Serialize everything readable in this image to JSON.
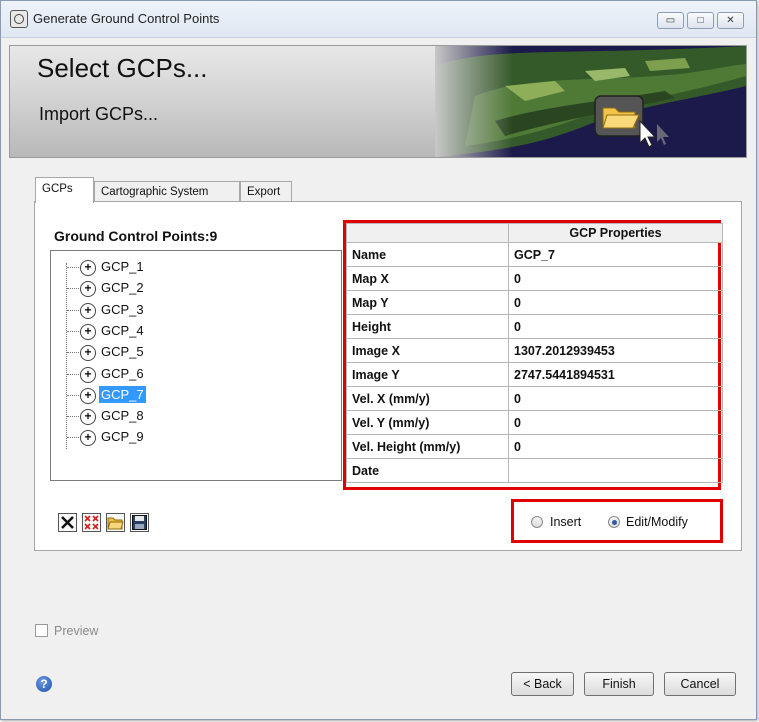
{
  "window": {
    "title": "Generate Ground Control Points",
    "minimize_glyph": "▭",
    "maximize_glyph": "□",
    "close_glyph": "✕"
  },
  "banner": {
    "title": "Select GCPs...",
    "subtitle": "Import GCPs..."
  },
  "tabs": [
    "GCPs",
    "Cartographic System",
    "Export"
  ],
  "gcp_list": {
    "heading": "Ground Control Points:",
    "count": "9",
    "items": [
      "GCP_1",
      "GCP_2",
      "GCP_3",
      "GCP_4",
      "GCP_5",
      "GCP_6",
      "GCP_7",
      "GCP_8",
      "GCP_9"
    ],
    "selected": "GCP_7"
  },
  "properties": {
    "header": "GCP Properties",
    "rows": [
      {
        "key": "Name",
        "value": "GCP_7"
      },
      {
        "key": "Map X",
        "value": "0"
      },
      {
        "key": "Map Y",
        "value": "0"
      },
      {
        "key": "Height",
        "value": "0"
      },
      {
        "key": "Image X",
        "value": "1307.2012939453"
      },
      {
        "key": "Image Y",
        "value": "2747.5441894531"
      },
      {
        "key": "Vel. X (mm/y)",
        "value": "0"
      },
      {
        "key": "Vel. Y (mm/y)",
        "value": "0"
      },
      {
        "key": "Vel. Height (mm/y)",
        "value": "0"
      },
      {
        "key": "Date",
        "value": ""
      }
    ]
  },
  "mode": {
    "insert_label": "Insert",
    "edit_label": "Edit/Modify",
    "selected": "edit"
  },
  "preview_label": "Preview",
  "buttons": {
    "back": "< Back",
    "finish": "Finish",
    "cancel": "Cancel"
  },
  "help_glyph": "?",
  "colors": {
    "highlight": "#e00000",
    "selection": "#3399ff"
  }
}
